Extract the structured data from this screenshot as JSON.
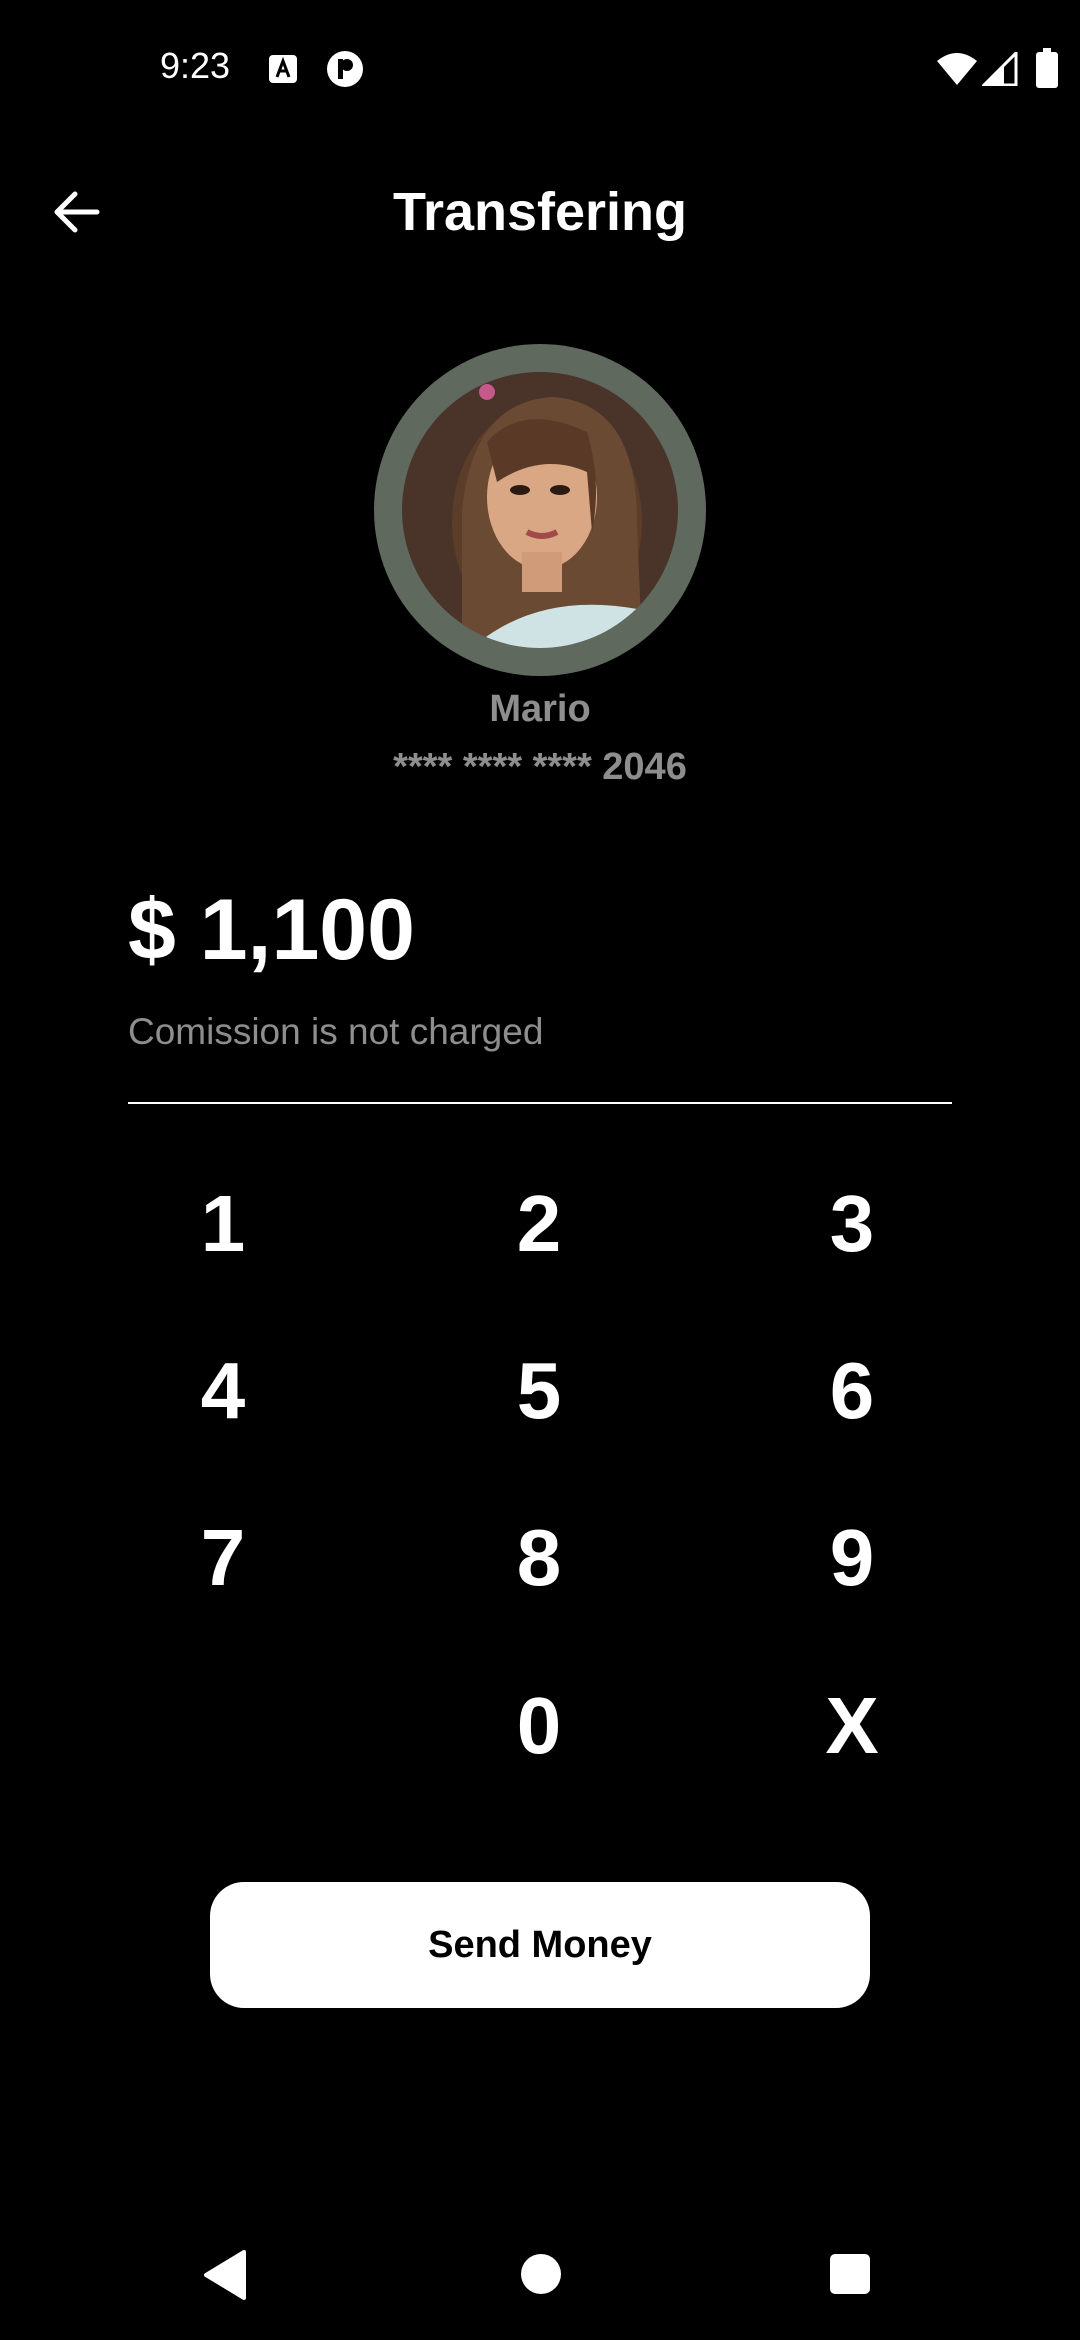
{
  "status_bar": {
    "time": "9:23",
    "icons": [
      "text-a-icon",
      "p-app-icon",
      "wifi-icon",
      "signal-icon",
      "battery-icon"
    ]
  },
  "header": {
    "title": "Transfering",
    "back_icon": "arrow-left-icon"
  },
  "recipient": {
    "name": "Mario",
    "card_number": "**** **** **** 2046"
  },
  "amount": {
    "value": "$ 1,100",
    "note": "Comission is not charged"
  },
  "keypad": {
    "keys": [
      "1",
      "2",
      "3",
      "4",
      "5",
      "6",
      "7",
      "8",
      "9",
      "0",
      "X"
    ]
  },
  "send_button": {
    "label": "Send Money"
  },
  "nav_bar": {
    "icons": [
      "nav-back-icon",
      "nav-home-icon",
      "nav-recents-icon"
    ]
  },
  "colors": {
    "background": "#000000",
    "text": "#ffffff",
    "muted_text": "#8e8e8e",
    "avatar_ring": "#5f695e",
    "button_bg": "#ffffff",
    "button_text": "#000000"
  }
}
